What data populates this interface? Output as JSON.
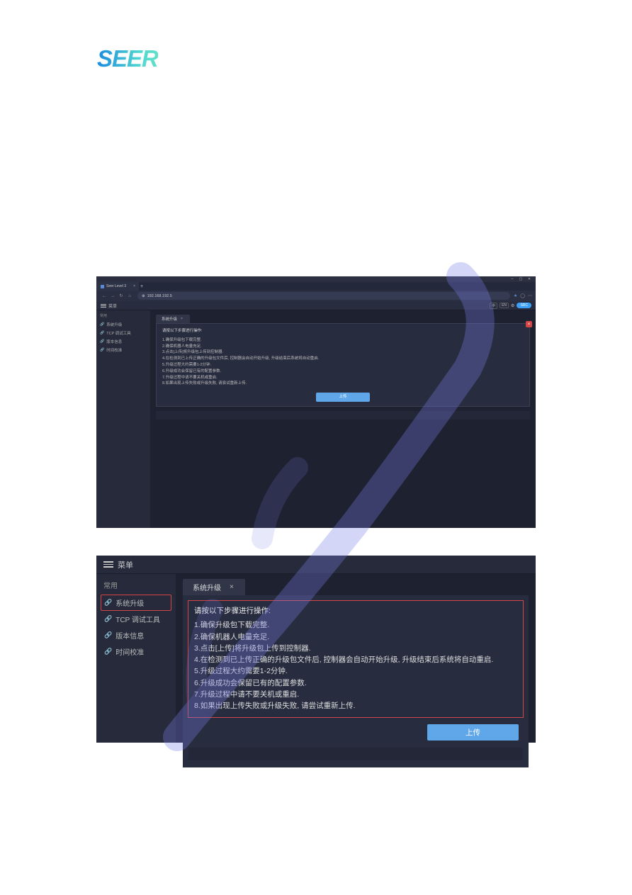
{
  "logo": {
    "text": "SEER"
  },
  "browser": {
    "tab_title": "Seer Level 3",
    "address": "192.168.192.5"
  },
  "app": {
    "menu_label": "菜单",
    "lang_zh": "中",
    "lang_en": "EN",
    "src_badge": "SRC"
  },
  "sidebar": {
    "section": "常用",
    "items": [
      {
        "label": "系统升级"
      },
      {
        "label": "TCP 调试工具"
      },
      {
        "label": "版本信息"
      },
      {
        "label": "时间校准"
      }
    ]
  },
  "upgrade": {
    "tab_label": "系统升级",
    "header": "请按以下步骤进行操作:",
    "steps": [
      "1.确保升级包下载完整.",
      "2.确保机器人电量充足.",
      "3.点击[上传]将升级包上传到控制器.",
      "4.在检测到已上传正确的升级包文件后, 控制器会自动开始升级, 升级结束后系统将自动重启.",
      "5.升级过程大约需要1-2分钟.",
      "6.升级成功会保留已有的配置参数.",
      "7.升级过程中请不要关机或重启.",
      "8.如果出现上传失败或升级失败, 请尝试重新上传."
    ],
    "upload_label": "上传"
  }
}
